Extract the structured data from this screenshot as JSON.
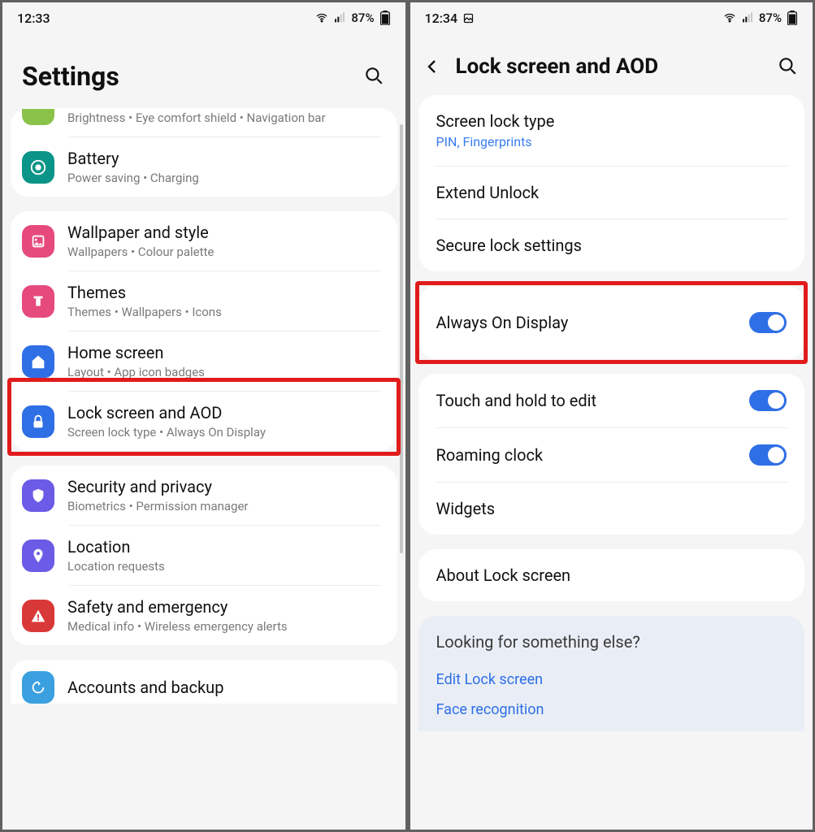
{
  "left": {
    "status": {
      "time": "12:33",
      "battery": "87%"
    },
    "header": {
      "title": "Settings"
    },
    "rows": {
      "display": {
        "title": "",
        "sub": "Brightness  •  Eye comfort shield  •  Navigation bar"
      },
      "battery": {
        "title": "Battery",
        "sub": "Power saving  •  Charging"
      },
      "wallpaper": {
        "title": "Wallpaper and style",
        "sub": "Wallpapers  •  Colour palette"
      },
      "themes": {
        "title": "Themes",
        "sub": "Themes  •  Wallpapers  •  Icons"
      },
      "home": {
        "title": "Home screen",
        "sub": "Layout  •  App icon badges"
      },
      "lock": {
        "title": "Lock screen and AOD",
        "sub": "Screen lock type  •  Always On Display"
      },
      "security": {
        "title": "Security and privacy",
        "sub": "Biometrics  •  Permission manager"
      },
      "location": {
        "title": "Location",
        "sub": "Location requests"
      },
      "safety": {
        "title": "Safety and emergency",
        "sub": "Medical info  •  Wireless emergency alerts"
      },
      "accounts": {
        "title": "Accounts and backup",
        "sub": ""
      }
    }
  },
  "right": {
    "status": {
      "time": "12:34",
      "battery": "87%"
    },
    "header": {
      "title": "Lock screen and AOD"
    },
    "rows": {
      "locktype": {
        "title": "Screen lock type",
        "sub": "PIN, Fingerprints"
      },
      "extend": {
        "title": "Extend Unlock"
      },
      "secure": {
        "title": "Secure lock settings"
      },
      "aod": {
        "title": "Always On Display",
        "toggle": true
      },
      "touch": {
        "title": "Touch and hold to edit",
        "toggle": true
      },
      "roaming": {
        "title": "Roaming clock",
        "toggle": true
      },
      "widgets": {
        "title": "Widgets"
      },
      "about": {
        "title": "About Lock screen"
      }
    },
    "lookfor": {
      "q": "Looking for something else?",
      "link1": "Edit Lock screen",
      "link2": "Face recognition"
    }
  }
}
